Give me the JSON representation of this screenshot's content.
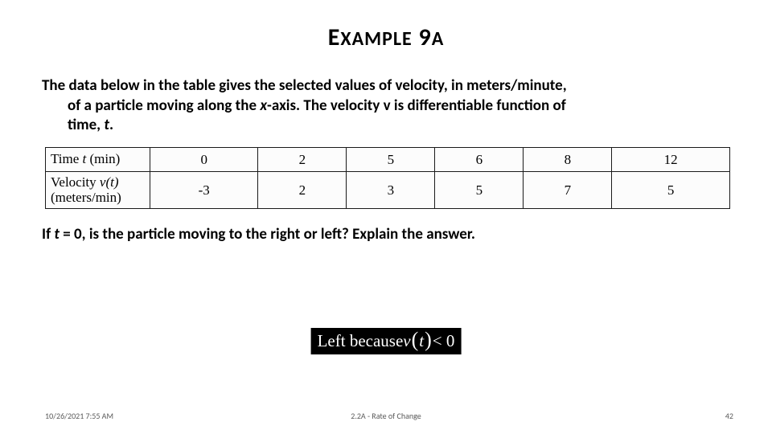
{
  "title": {
    "word1_maj": "E",
    "word1_rest": "XAMPLE",
    "word2_maj": "9",
    "word2_rest": "A"
  },
  "prompt": {
    "line1": "The data below in the table gives the selected values of velocity, in meters/minute,",
    "line2_pre": "of a particle moving along the ",
    "line2_x": "x",
    "line2_mid": "-axis.  The velocity v is differentiable function of",
    "line3_pre": "time, ",
    "line3_t": "t",
    "line3_post": "."
  },
  "chart_data": {
    "type": "table",
    "row_labels": [
      "Time t (min)",
      "Velocity v(t) (meters/min)"
    ],
    "columns": [
      "0",
      "2",
      "5",
      "6",
      "8",
      "12"
    ],
    "rows": {
      "time": [
        "0",
        "2",
        "5",
        "6",
        "8",
        "12"
      ],
      "velocity": [
        "-3",
        "2",
        "3",
        "5",
        "7",
        "5"
      ]
    }
  },
  "table_labels": {
    "time_pre": "Time ",
    "time_var": "t",
    "time_post": " (min)",
    "vel_pre": "Velocity ",
    "vel_var": "v(t)",
    "vel_post": "(meters/min)"
  },
  "question": {
    "pre": "If ",
    "t": "t",
    "post": " = 0, is the particle moving to the right or left?  Explain the answer."
  },
  "answer": {
    "pre": "Left because ",
    "fn": "v",
    "arg": "t",
    "post": "< 0"
  },
  "footer": {
    "left": "10/26/2021 7:55 AM",
    "center": "2.2A - Rate of Change",
    "right": "42"
  }
}
